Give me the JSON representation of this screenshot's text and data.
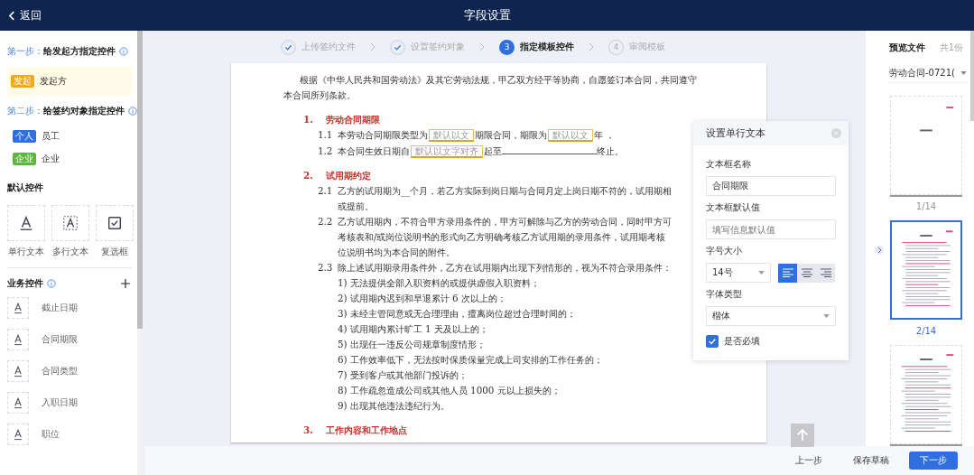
{
  "header": {
    "back": "返回",
    "title": "字段设置"
  },
  "sidebar": {
    "step1": {
      "prefix": "第一步：",
      "title": "给发起方指定控件"
    },
    "initiators": [
      {
        "tag": "发起",
        "label": "发起方",
        "color": "#f0a81c"
      }
    ],
    "step2": {
      "prefix": "第二步：",
      "title": "给签约对象指定控件"
    },
    "signers": [
      {
        "tag": "个人",
        "label": "员工",
        "color": "#2f6fe0"
      },
      {
        "tag": "企业",
        "label": "企业",
        "color": "#5cb83c"
      }
    ],
    "default_title": "默认控件",
    "default_controls": [
      {
        "kind": "single",
        "label": "单行文本"
      },
      {
        "kind": "multi",
        "label": "多行文本"
      },
      {
        "kind": "checkbox",
        "label": "复选框"
      }
    ],
    "business_title": "业务控件",
    "business_controls": [
      "截止日期",
      "合同期限",
      "合同类型",
      "入职日期",
      "职位"
    ]
  },
  "steps": [
    {
      "label": "上传签约文件",
      "done": true,
      "selected": false
    },
    {
      "label": "设置签约对象",
      "done": true,
      "selected": false
    },
    {
      "number": "3",
      "label": "指定模板控件",
      "done": false,
      "selected": true
    },
    {
      "number": "4",
      "label": "审阅模板",
      "done": false,
      "selected": false
    }
  ],
  "document": [
    {
      "kind": "para",
      "text": "根据《中华人民共和国劳动法》及其它劳动法规，甲乙双方经平等协商，自愿签订本合同，共同遵守"
    },
    {
      "kind": "cont",
      "text": "本合同所列条款。"
    },
    {
      "kind": "heading",
      "number": "1.",
      "text": "劳动合同期限"
    },
    {
      "kind": "clause",
      "number": "1.1",
      "segments": [
        {
          "kind": "text",
          "text": "本劳动合同期限类型为"
        },
        {
          "kind": "field",
          "text": "默认以文"
        },
        {
          "kind": "text",
          "text": "期限合同，期限为"
        },
        {
          "kind": "field",
          "text": "默认以文"
        },
        {
          "kind": "text",
          "text": "年 ，"
        }
      ]
    },
    {
      "kind": "clause",
      "number": "1.2",
      "segments": [
        {
          "kind": "text",
          "text": "本合同生效日期自"
        },
        {
          "kind": "field",
          "text": "默认以文字对齐"
        },
        {
          "kind": "text",
          "text": "起至"
        },
        {
          "kind": "blank"
        },
        {
          "kind": "text",
          "text": "终止。"
        }
      ]
    },
    {
      "kind": "heading",
      "number": "2.",
      "text": "试用期约定"
    },
    {
      "kind": "clause",
      "number": "2.1",
      "segments": [
        {
          "kind": "text",
          "text": "乙方的试用期为__个月，若乙方实际到岗日期与合同月定上岗日期不符的，试用期相"
        }
      ]
    },
    {
      "kind": "sub",
      "text": "或提前。"
    },
    {
      "kind": "clause",
      "number": "2.2",
      "segments": [
        {
          "kind": "text",
          "text": "乙方试用期内，不符合甲方录用条件的，甲方可解除与乙方的劳动合同，同时甲方可"
        }
      ]
    },
    {
      "kind": "sub",
      "text": "考核表和/或岗位说明书的形式向乙方明确考核乙方试用期的录用条件，试用期考核"
    },
    {
      "kind": "sub",
      "text": "位说明书均为本合同的附件。"
    },
    {
      "kind": "clause",
      "number": "2.3",
      "segments": [
        {
          "kind": "text",
          "text": "除上述试用期录用条件外，乙方在试用期内出现下列情形的，视为不符合录用条件："
        }
      ]
    },
    {
      "kind": "sub",
      "text": "1) 无法提供全部入职资料的或提供虚假入职资料；"
    },
    {
      "kind": "sub",
      "text": "2) 试用期内迟到和早退累计 6 次以上的；"
    },
    {
      "kind": "sub",
      "text": "3) 未经主管同意或无合理理由，擅离岗位超过合理时间的；"
    },
    {
      "kind": "sub",
      "text": "4) 试用期内累计旷工 1 天及以上的；"
    },
    {
      "kind": "sub",
      "text": "5) 出现任一违反公司规章制度情形；"
    },
    {
      "kind": "sub",
      "text": "6) 工作效率低下，无法按时保质保量完成上司安排的工作任务的；"
    },
    {
      "kind": "sub",
      "text": "7) 受到客户或其他部门投诉的；"
    },
    {
      "kind": "sub",
      "text": "8) 工作疏忽造成公司或其他人员 1000 元以上损失的；"
    },
    {
      "kind": "sub",
      "text": "9) 出现其他违法违纪行为。"
    },
    {
      "kind": "heading",
      "number": "3.",
      "text": "工作内容和工作地点"
    }
  ],
  "popup": {
    "title": "设置单行文本",
    "name_label": "文本框名称",
    "name_value": "合同期限",
    "default_label": "文本框默认值",
    "default_placeholder": "填写信息默认值",
    "size_label": "字号大小",
    "size_value": "14号",
    "align": [
      {
        "kind": "left",
        "selected": true
      },
      {
        "kind": "center",
        "selected": false
      },
      {
        "kind": "right",
        "selected": false
      }
    ],
    "font_label": "字体类型",
    "font_value": "楷体",
    "required_label": "是否必填",
    "required": true
  },
  "preview": {
    "title": "预览文件",
    "count": "共1份",
    "file": "劳动合同-0721(",
    "pages": [
      {
        "label": "1/14",
        "kind": "cover",
        "selected": false
      },
      {
        "label": "2/14",
        "kind": "text",
        "selected": true
      },
      {
        "kind": "text",
        "selected": false
      }
    ]
  },
  "footer": {
    "prev": "上一步",
    "save": "保存草稿",
    "next": "下一步"
  }
}
